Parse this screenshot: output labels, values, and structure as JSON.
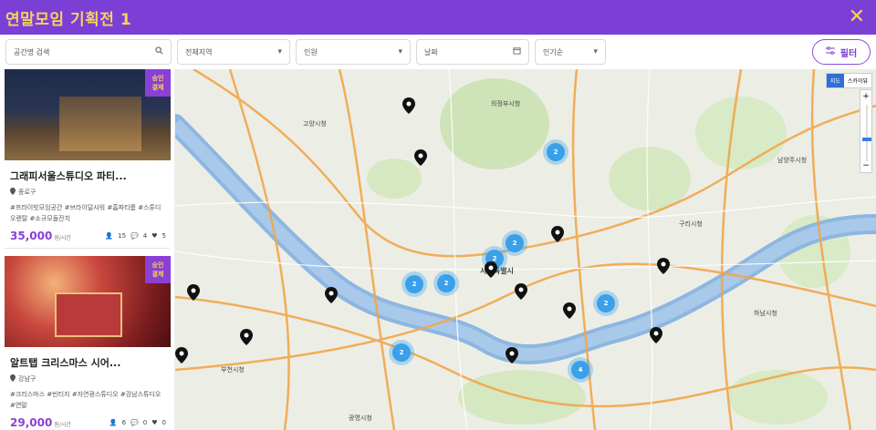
{
  "header": {
    "title": "연말모임 기획전 1",
    "close_icon": "close-icon",
    "color": "#7c3fd6",
    "title_color": "#f6d25a"
  },
  "filters": {
    "search_placeholder": "공간명 검색",
    "region": "전체지역",
    "people": "인원",
    "date": "날짜",
    "sort": "인기순",
    "filter_button": "필터"
  },
  "cards": [
    {
      "badge": "승인\n결제",
      "title": "그래피서울스튜디오 파티...",
      "location": "종로구",
      "tags": "#프라이빗모임공간 #브라이덜샤워 #홈파티룸 #스튜디오렌탈 #소규모돌잔치",
      "price": "35,000",
      "unit": "원/시간",
      "people": "15",
      "comments": "4",
      "likes": "5"
    },
    {
      "badge": "승인\n결제",
      "title": "알트탭 크리스마스 시어...",
      "location": "강남구",
      "tags": "#크리스마스 #빈티지 #자연광스튜디오 #강남스튜디오 #연말",
      "price": "29,000",
      "unit": "원/시간",
      "people": "6",
      "comments": "0",
      "likes": "0"
    }
  ],
  "map": {
    "type_map": "지도",
    "type_sky": "스카이뷰",
    "zoom_in": "+",
    "zoom_out": "−",
    "labels": [
      "고양시청",
      "의정부시청",
      "서울특별시",
      "구리시청",
      "남양주시청",
      "하남시청",
      "부천시청",
      "광명시청"
    ],
    "clusters": [
      "2",
      "2",
      "2",
      "2",
      "2",
      "2",
      "2",
      "4"
    ]
  }
}
